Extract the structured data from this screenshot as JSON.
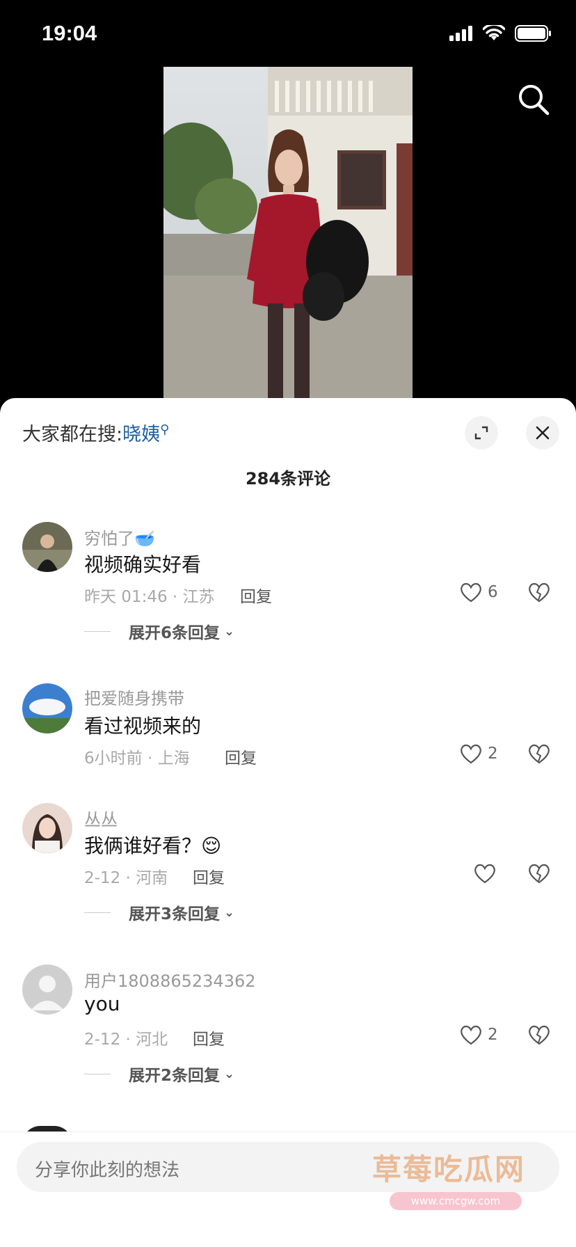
{
  "status_bar": {
    "time": "19:04"
  },
  "hot_search": {
    "label": "大家都在搜:",
    "keyword": "晓姨"
  },
  "comments_count": "284条评论",
  "comments": [
    {
      "user": "穷怕了🥣",
      "text": "视频确实好看",
      "meta": "昨天 01:46 · 江苏",
      "reply": "回复",
      "likes": "6",
      "expand": "展开6条回复"
    },
    {
      "user": "把爱随身携带",
      "text": "看过视频来的",
      "meta": "6小时前 · 上海",
      "reply": "回复",
      "likes": "2",
      "expand": ""
    },
    {
      "user": "丛丛",
      "text": "我俩谁好看？😌",
      "meta": "2-12 · 河南",
      "reply": "回复",
      "likes": "",
      "expand": "展开3条回复"
    },
    {
      "user": "用户1808865234362",
      "text": "you",
      "meta": "2-12 · 河北",
      "reply": "回复",
      "likes": "2",
      "expand": "展开2条回复"
    }
  ],
  "input": {
    "placeholder": "分享你此刻的想法"
  },
  "watermark": {
    "title": "草莓吃瓜网",
    "url": "www.cmcgw.com"
  }
}
